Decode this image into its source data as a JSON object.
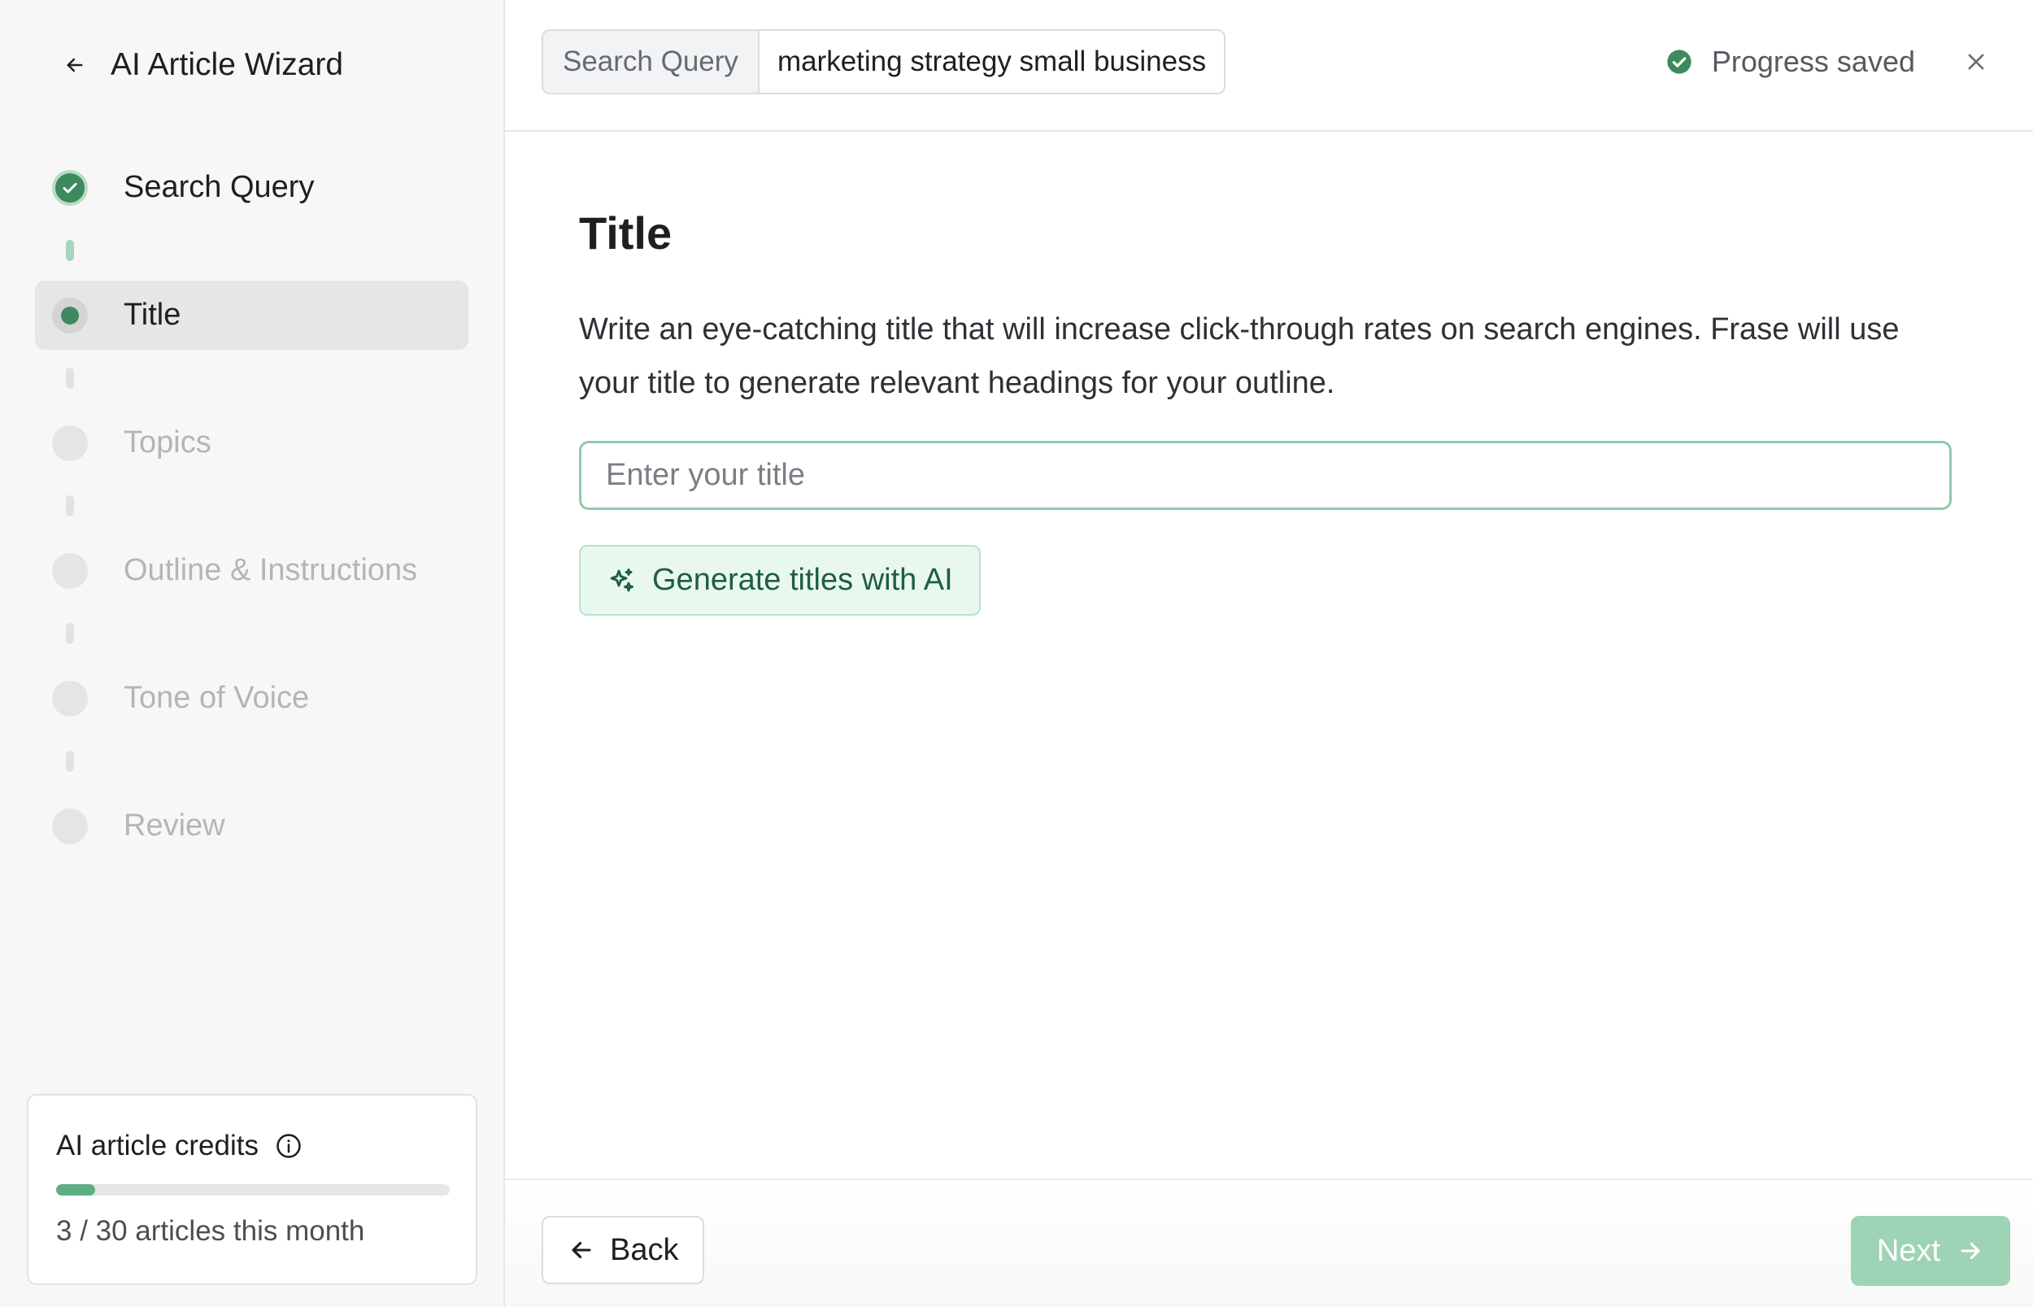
{
  "sidebar": {
    "title": "AI Article Wizard",
    "steps": [
      {
        "label": "Search Query",
        "state": "done"
      },
      {
        "label": "Title",
        "state": "active"
      },
      {
        "label": "Topics",
        "state": "pending"
      },
      {
        "label": "Outline & Instructions",
        "state": "pending"
      },
      {
        "label": "Tone of Voice",
        "state": "pending"
      },
      {
        "label": "Review",
        "state": "pending"
      }
    ],
    "credits": {
      "title": "AI article credits",
      "used": 3,
      "total": 30,
      "progress_percent": 10,
      "text": "3 / 30 articles this month"
    }
  },
  "topbar": {
    "query_label": "Search Query",
    "query_value": "marketing strategy small business",
    "status_text": "Progress saved"
  },
  "main": {
    "title": "Title",
    "description": "Write an eye-catching title that will increase click-through rates on search engines. Frase will use your title to generate relevant headings for your outline.",
    "input_placeholder": "Enter your title",
    "input_value": "",
    "generate_label": "Generate titles with AI"
  },
  "footer": {
    "back_label": "Back",
    "next_label": "Next"
  },
  "colors": {
    "accent": "#3e8a5e",
    "accent_light": "#e8f8ee",
    "next_disabled": "#9fd3b5"
  }
}
